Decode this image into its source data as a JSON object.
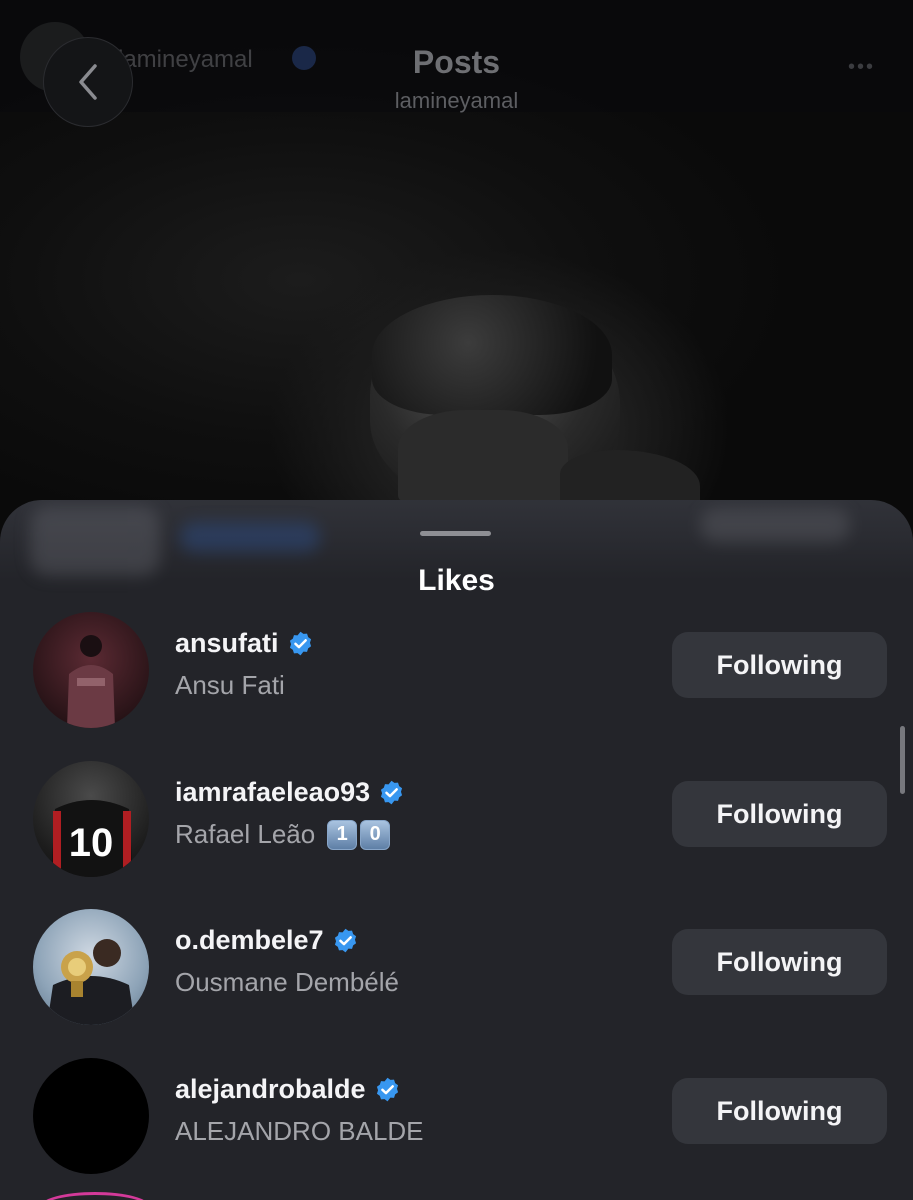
{
  "header": {
    "title": "Posts",
    "subtitle": "lamineyamal",
    "faded_username": "lamineyamal"
  },
  "sheet": {
    "title": "Likes"
  },
  "likes": [
    {
      "username": "ansufati",
      "full_name": "Ansu Fati",
      "button": "Following",
      "verified": true
    },
    {
      "username": "iamrafaeleao93",
      "full_name": "Rafael Leão",
      "badges": [
        "1",
        "0"
      ],
      "button": "Following",
      "verified": true,
      "avatar_jersey_text": "10"
    },
    {
      "username": "o.dembele7",
      "full_name": "Ousmane Dembélé",
      "button": "Following",
      "verified": true
    },
    {
      "username": "alejandrobalde",
      "full_name": "ALEJANDRO BALDE",
      "button": "Following",
      "verified": true
    }
  ],
  "colors": {
    "verified": "#3897f0",
    "sheet_bg": "#232429",
    "button_bg": "#34363c",
    "next_story_ring": "#d43a9a"
  },
  "icons": {
    "back": "chevron-left-icon",
    "verified": "verified-badge-icon",
    "more": "more-icon"
  }
}
